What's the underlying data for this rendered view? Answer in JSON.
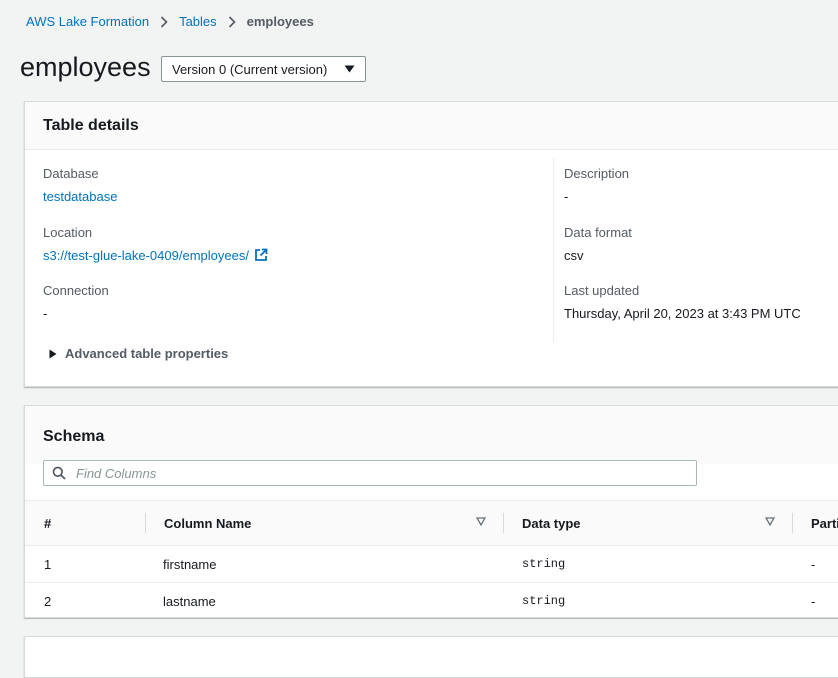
{
  "breadcrumb": {
    "items": [
      "AWS Lake Formation",
      "Tables"
    ],
    "current": "employees"
  },
  "page": {
    "title": "employees",
    "version_select": "Version 0 (Current version)"
  },
  "table_details": {
    "heading": "Table details",
    "database_label": "Database",
    "database_value": "testdatabase",
    "location_label": "Location",
    "location_value": "s3://test-glue-lake-0409/employees/",
    "connection_label": "Connection",
    "connection_value": "-",
    "description_label": "Description",
    "description_value": "-",
    "data_format_label": "Data format",
    "data_format_value": "csv",
    "last_updated_label": "Last updated",
    "last_updated_value": "Thursday, April 20, 2023 at 3:43 PM UTC",
    "advanced_label": "Advanced table properties"
  },
  "schema": {
    "heading": "Schema",
    "search_placeholder": "Find Columns",
    "columns": [
      "#",
      "Column Name",
      "Data type",
      "Parti"
    ],
    "rows": [
      {
        "num": "1",
        "name": "firstname",
        "type": "string",
        "partition": "-"
      },
      {
        "num": "2",
        "name": "lastname",
        "type": "string",
        "partition": "-"
      }
    ]
  },
  "colors": {
    "link": "#0073bb",
    "background": "#f2f3f3",
    "text": "#16191f"
  },
  "icons": [
    "chevron-right-icon",
    "caret-down-icon",
    "external-link-icon",
    "triangle-right-icon",
    "search-icon",
    "sort-icon"
  ]
}
